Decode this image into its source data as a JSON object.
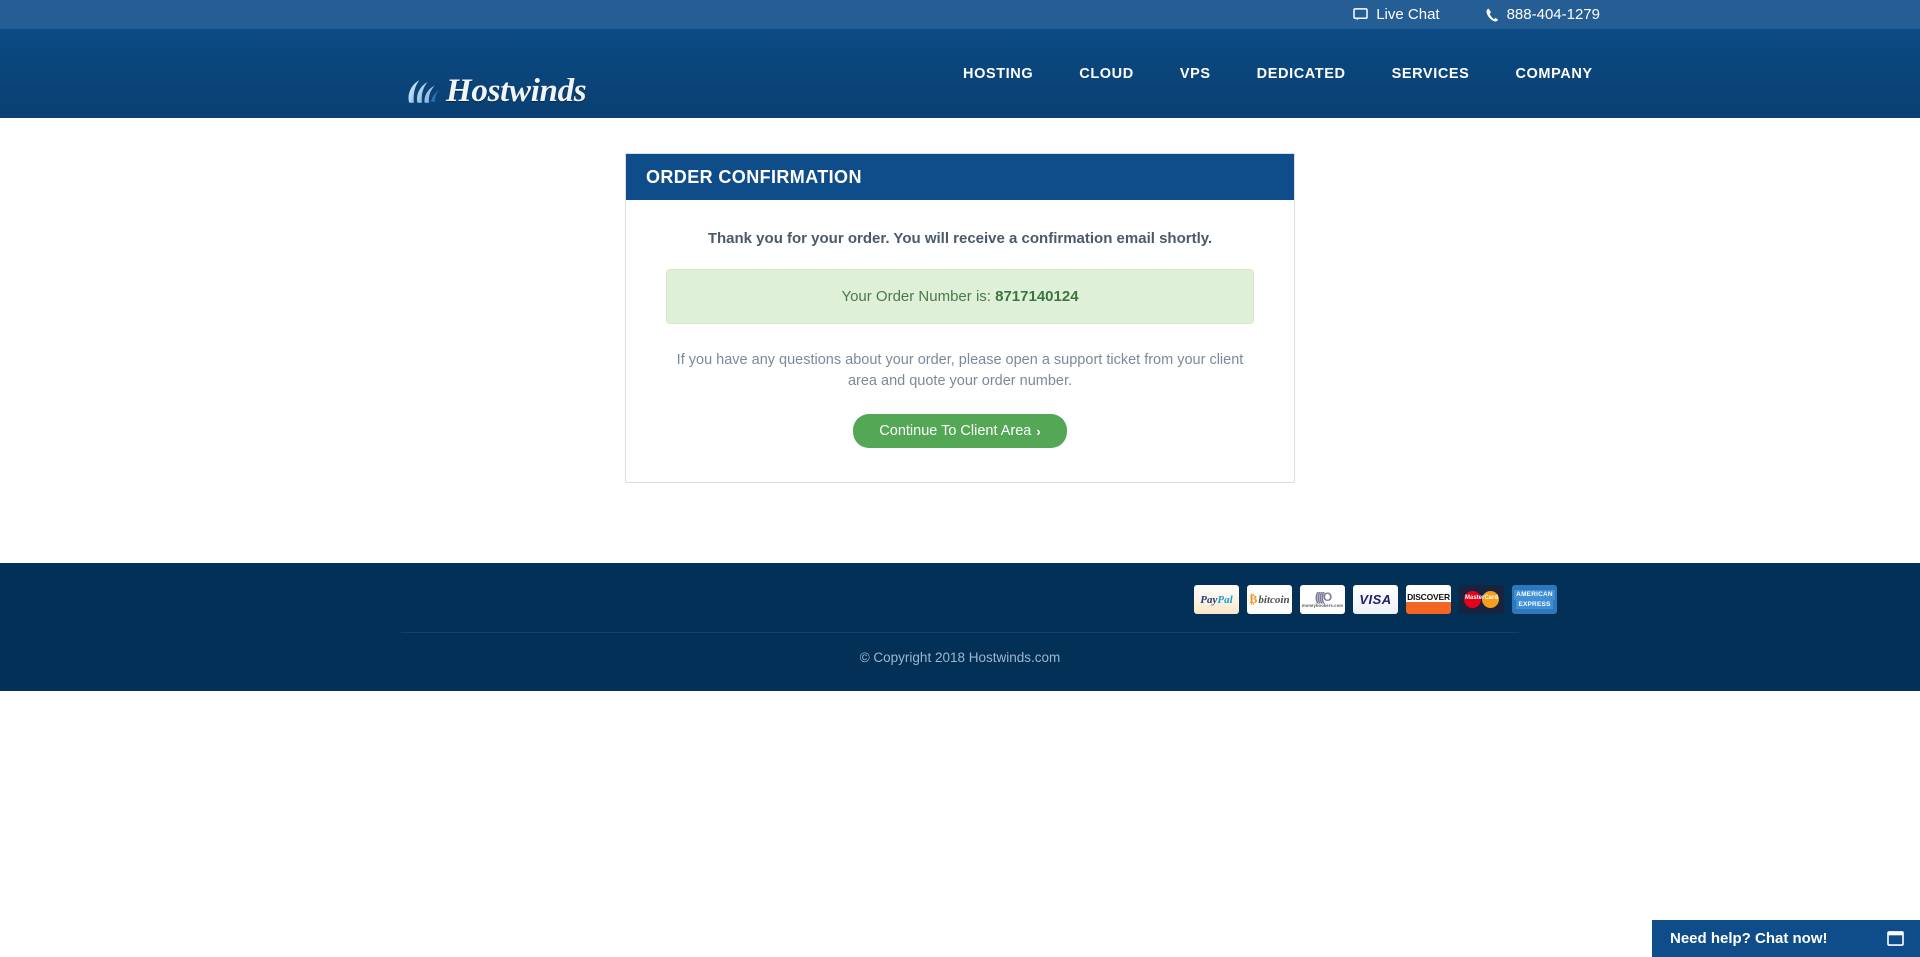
{
  "topbar": {
    "live_chat": {
      "label": "Live Chat",
      "icon": "chat-bubble-icon"
    },
    "phone": {
      "label": "888-404-1279",
      "icon": "phone-icon"
    }
  },
  "header": {
    "logo_text": "Hostwinds",
    "logo_icon": "wave-swoosh-icon",
    "nav": [
      {
        "label": "HOSTING",
        "name": "nav-item-hosting"
      },
      {
        "label": "CLOUD",
        "name": "nav-item-cloud"
      },
      {
        "label": "VPS",
        "name": "nav-item-vps"
      },
      {
        "label": "DEDICATED",
        "name": "nav-item-dedicated"
      },
      {
        "label": "SERVICES",
        "name": "nav-item-services"
      },
      {
        "label": "COMPANY",
        "name": "nav-item-company"
      }
    ]
  },
  "main": {
    "panel_title": "ORDER CONFIRMATION",
    "lead": "Thank you for your order. You will receive a confirmation email shortly.",
    "order_label": "Your Order Number is:",
    "order_number": "8717140124",
    "note": "If you have any questions about your order, please open a support ticket from your client area and quote your order number.",
    "cta_label": "Continue To Client Area",
    "cta_chevron": "›"
  },
  "footer": {
    "payments": [
      {
        "name": "paypal-icon",
        "label": "PayPal"
      },
      {
        "name": "bitcoin-icon",
        "label": "bitcoin"
      },
      {
        "name": "moneybookers-icon",
        "label": "moneybookers.com"
      },
      {
        "name": "visa-icon",
        "label": "VISA"
      },
      {
        "name": "discover-icon",
        "label": "DISCOVER"
      },
      {
        "name": "mastercard-icon",
        "label": "MasterCard"
      },
      {
        "name": "amex-icon",
        "label": "AMERICAN EXPRESS"
      }
    ],
    "copyright": "© Copyright 2018 Hostwinds.com"
  },
  "chat_widget": {
    "label": "Need help? Chat now!",
    "icon": "window-maximize-icon"
  },
  "colors": {
    "topbar_blue": "#255e95",
    "header_blue": "#0b4a84",
    "panel_head_blue": "#0f4d8a",
    "footer_navy": "#033056",
    "success_green_bg": "#dff0d8",
    "button_green": "#54a754"
  }
}
